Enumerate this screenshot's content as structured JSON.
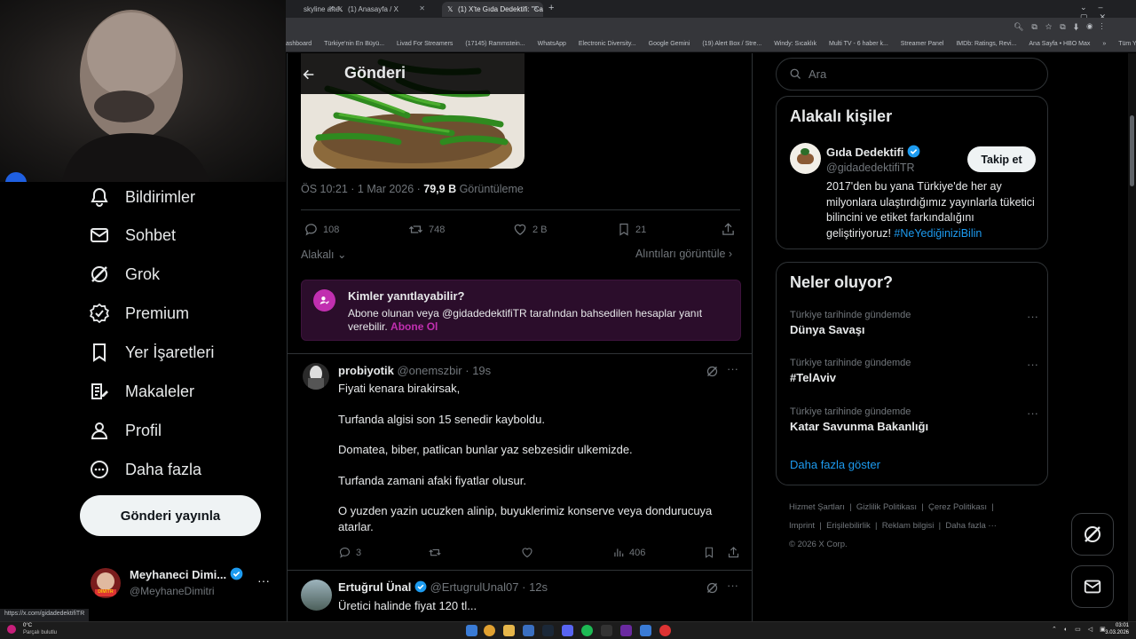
{
  "browser": {
    "tabs": [
      {
        "label": "skyline after"
      },
      {
        "label": "(1) Anasayfa / X"
      },
      {
        "label": "(1) X'te Gıda Dedektifi: \"Carref"
      }
    ],
    "bookmarks": [
      "ashboard",
      "Türkiye'nin En Büyü...",
      "Livad For Streamers",
      "(17145) Rammstein...",
      "WhatsApp",
      "Electronic Diversity...",
      "Google Gemini",
      "(19) Alert Box / Stre...",
      "Windy: Sıcaklık",
      "Multi TV - 6 haber k...",
      "Streamer Panel",
      "IMDb: Ratings, Revi...",
      "Ana Sayfa • HBO Max"
    ],
    "bookmarks_more": "»",
    "all_bookmarks": "Tüm Yer İşaretleri"
  },
  "nav": {
    "items": [
      {
        "label": "Bildirimler"
      },
      {
        "label": "Sohbet"
      },
      {
        "label": "Grok"
      },
      {
        "label": "Premium"
      },
      {
        "label": "Yer İşaretleri"
      },
      {
        "label": "Makaleler"
      },
      {
        "label": "Profil"
      },
      {
        "label": "Daha fazla"
      }
    ],
    "post_button": "Gönderi yayınla",
    "account": {
      "name": "Meyhaneci Dimi...",
      "handle": "@MeyhaneDimitri"
    }
  },
  "header": {
    "title": "Gönderi"
  },
  "post": {
    "time": "ÖS 10:21 · 1 Mar 2026 · ",
    "views_count": "79,9 B",
    "views_label": " Görüntüleme",
    "stats": {
      "replies": "108",
      "reposts": "748",
      "likes": "2 B",
      "bookmarks": "21"
    },
    "relevant": "Alakalı",
    "quotes_link": "Alıntıları görüntüle",
    "reply_restrict": {
      "title": "Kimler yanıtlayabilir?",
      "text": "Abone olunan veya @gidadedektifiTR tarafından bahsedilen hesaplar yanıt verebilir.",
      "link": "Abone Ol"
    }
  },
  "replies": [
    {
      "name": "probiyotik",
      "handle": "@onemszbir",
      "time": "· 19s",
      "lines": [
        "Fiyati kenara birakirsak,",
        "Turfanda algisi son 15 senedir kayboldu.",
        "Domatea, biber, patlican bunlar yaz sebzesidir ulkemizde.",
        "Turfanda zamani afaki fiyatlar olusur.",
        "O yuzden yazin ucuzken alinip, buyuklerimiz konserve veya dondurucuya atarlar."
      ],
      "replies": "3",
      "views": "406"
    },
    {
      "name": "Ertuğrul Ünal",
      "handle": "@ErtugrulUnal07",
      "time": "· 12s",
      "text": "Üretici halinde fiyat 120 tl..."
    }
  ],
  "sidebar": {
    "search_placeholder": "Ara",
    "related": {
      "title": "Alakalı kişiler",
      "name": "Gıda Dedektifi",
      "handle": "@gidadedektifiTR",
      "follow": "Takip et",
      "bio": "2017'den bu yana Türkiye'de her ay milyonlara ulaştırdığımız yayınlarla tüketici bilincini ve etiket farkındalığını geliştiriyoruz!",
      "hashtag": "#NeYediğiniziBilin"
    },
    "trends": {
      "title": "Neler oluyor?",
      "items": [
        {
          "category": "Türkiye tarihinde gündemde",
          "name": "Dünya Savaşı"
        },
        {
          "category": "Türkiye tarihinde gündemde",
          "name": "#TelAviv"
        },
        {
          "category": "Türkiye tarihinde gündemde",
          "name": "Katar Savunma Bakanlığı"
        }
      ],
      "more": "Daha fazla göster"
    },
    "footer": [
      "Hizmet Şartları",
      "Gizlilik Politikası",
      "Çerez Politikası",
      "Imprint",
      "Erişilebilirlik",
      "Reklam bilgisi",
      "Daha fazla ···"
    ],
    "copyright": "© 2026 X Corp."
  },
  "status_url": "https://x.com/gidadedektifiTR",
  "taskbar": {
    "weather_temp": "0°C",
    "weather_text": "Parçalı bulutlu",
    "time": "03:01",
    "date": "3.03.2026"
  },
  "colors": {
    "accent": "#1d9bf0",
    "purple": "#c12fb0",
    "bg": "#000000"
  }
}
